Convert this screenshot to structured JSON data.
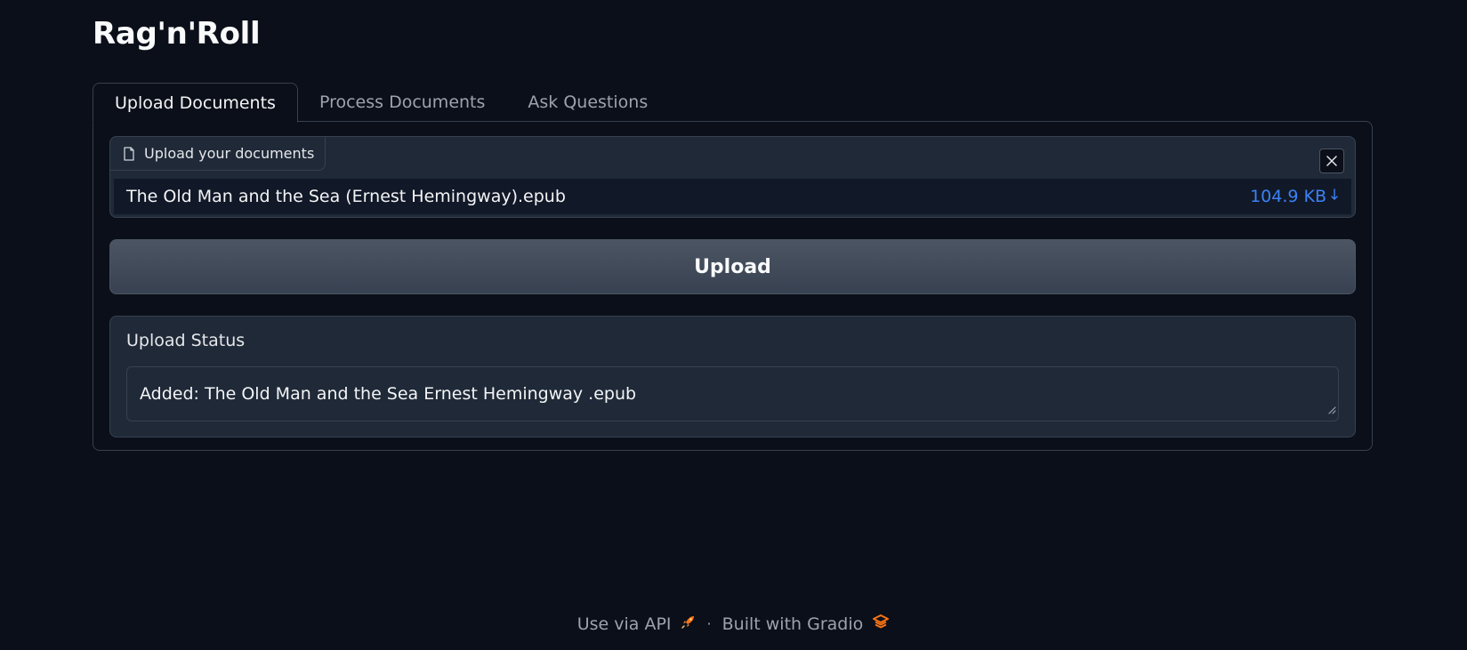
{
  "app": {
    "title": "Rag'n'Roll"
  },
  "tabs": [
    {
      "label": "Upload Documents",
      "active": true
    },
    {
      "label": "Process Documents",
      "active": false
    },
    {
      "label": "Ask Questions",
      "active": false
    }
  ],
  "upload": {
    "label": "Upload your documents",
    "label_icon": "file-icon",
    "clear_icon": "close-icon",
    "file": {
      "name": "The Old Man and the Sea (Ernest Hemingway).epub",
      "size": "104.9 KB",
      "download_icon": "download-arrow-icon"
    },
    "button_label": "Upload"
  },
  "status": {
    "label": "Upload Status",
    "value": "Added: The Old Man and the Sea Ernest Hemingway .epub"
  },
  "footer": {
    "api_label": "Use via API",
    "api_icon": "rocket-icon",
    "separator": "·",
    "built_label": "Built with Gradio",
    "gradio_icon": "gradio-logo-icon"
  },
  "colors": {
    "background": "#0b0f19",
    "panel": "#1f2937",
    "border": "#374151",
    "accent_link": "#3b82f6",
    "brand_orange": "#f97316"
  }
}
